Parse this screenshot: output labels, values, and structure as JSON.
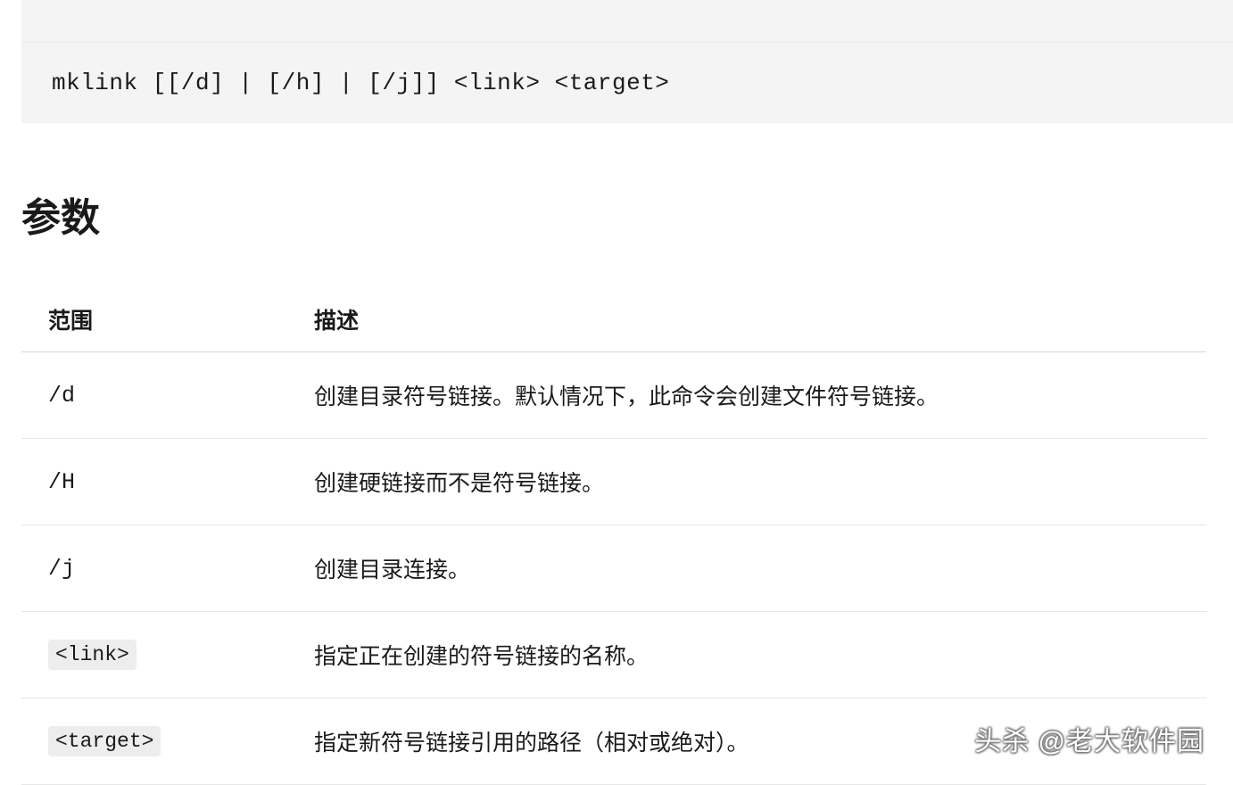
{
  "code_block": "mklink [[/d] | [/h] | [/j]] <link> <target>",
  "section_title": "参数",
  "table": {
    "headers": {
      "scope": "范围",
      "description": "描述"
    },
    "rows": [
      {
        "param": "/d",
        "pill": false,
        "desc": "创建目录符号链接。默认情况下，此命令会创建文件符号链接。"
      },
      {
        "param": "/H",
        "pill": false,
        "desc": "创建硬链接而不是符号链接。"
      },
      {
        "param": "/j",
        "pill": false,
        "desc": "创建目录连接。"
      },
      {
        "param": "<link>",
        "pill": true,
        "desc": "指定正在创建的符号链接的名称。"
      },
      {
        "param": "<target>",
        "pill": true,
        "desc": "指定新符号链接引用的路径（相对或绝对）。"
      }
    ]
  },
  "watermark": "头杀 @老大软件园"
}
